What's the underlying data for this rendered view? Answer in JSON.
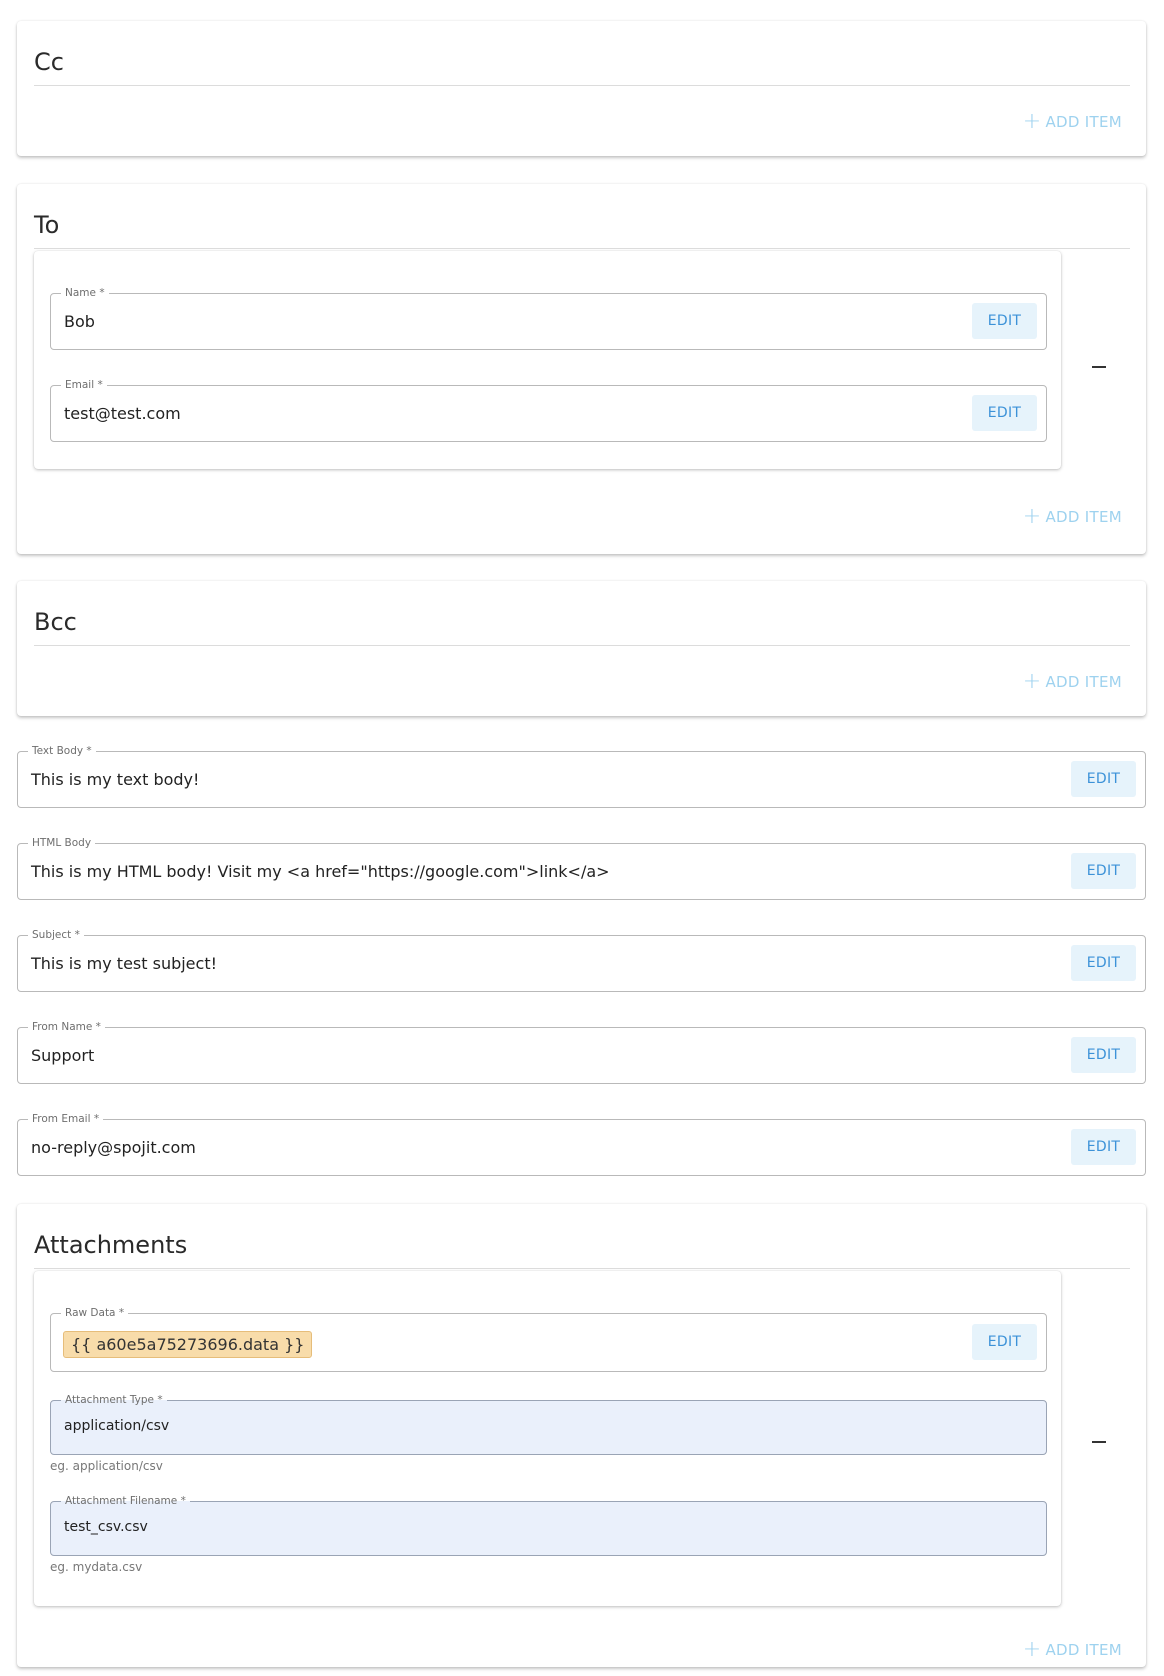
{
  "cc": {
    "title": "Cc",
    "add_label": "ADD ITEM"
  },
  "to": {
    "title": "To",
    "add_label": "ADD ITEM",
    "items": [
      {
        "name": {
          "label": "Name *",
          "value": "Bob",
          "edit": "EDIT"
        },
        "email": {
          "label": "Email *",
          "value": "test@test.com",
          "edit": "EDIT"
        }
      }
    ]
  },
  "bcc": {
    "title": "Bcc",
    "add_label": "ADD ITEM"
  },
  "text_body": {
    "label": "Text Body *",
    "value": "This is my text body!",
    "edit": "EDIT"
  },
  "html_body": {
    "label": "HTML Body",
    "value": "This is my HTML body! Visit my <a href=\"https://google.com\">link</a>",
    "edit": "EDIT"
  },
  "subject": {
    "label": "Subject *",
    "value": "This is my test subject!",
    "edit": "EDIT"
  },
  "from_name": {
    "label": "From Name *",
    "value": "Support",
    "edit": "EDIT"
  },
  "from_email": {
    "label": "From Email *",
    "value": "no-reply@spojit.com",
    "edit": "EDIT"
  },
  "attachments": {
    "title": "Attachments",
    "add_label": "ADD ITEM",
    "items": [
      {
        "raw_data": {
          "label": "Raw Data *",
          "value": "{{ a60e5a75273696.data }}",
          "edit": "EDIT"
        },
        "type": {
          "label": "Attachment Type *",
          "value": "application/csv",
          "helper": "eg. application/csv"
        },
        "filename": {
          "label": "Attachment Filename *",
          "value": "test_csv.csv",
          "helper": "eg. mydata.csv"
        }
      }
    ]
  },
  "colors": {
    "accent": "#3c92d8",
    "add_item": "#9ed2ef",
    "edit_bg": "#e6f3fb",
    "chip_bg": "#f8dcaa",
    "filled_bg": "#eaf0fb"
  }
}
